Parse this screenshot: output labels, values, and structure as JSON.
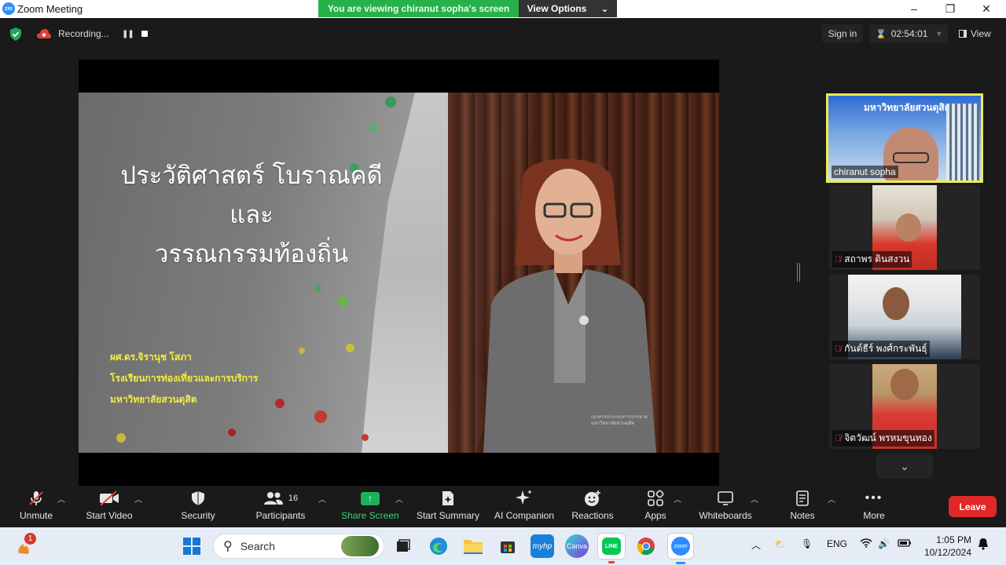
{
  "window": {
    "logo": "zm",
    "title": "Zoom Meeting",
    "controls": [
      "–",
      "❐",
      "✕"
    ]
  },
  "viewing_banner": {
    "message": "You are viewing chiranut sopha's screen",
    "options_label": "View Options"
  },
  "topbar": {
    "recording_label": "Recording...",
    "signin_label": "Sign in",
    "timer": "02:54:01",
    "view_label": "View"
  },
  "slide": {
    "title_lines": [
      "ประวัติศาสตร์ โบราณคดี",
      "และ",
      "วรรณกรรมท้องถิ่น"
    ],
    "author_lines": [
      "ผศ.ดร.จิรานุช  โสภา",
      "โรงเรียนการท่องเที่ยวและการบริการ",
      "มหาวิทยาลัยสวนดุสิต"
    ],
    "caption_lines": [
      "เอกสารประกอบการบรรยาย",
      "มหาวิทยาลัยสวนดุสิต"
    ]
  },
  "gallery": {
    "active_banner": "มหาวิทยาลัยสวนดุสิต",
    "participants": [
      {
        "name": "chiranut sopha",
        "muted": false
      },
      {
        "name": "สถาพร  ดินสงวน",
        "muted": true
      },
      {
        "name": "กันต์ธีร์ พงศ์กระพันธุ์",
        "muted": true
      },
      {
        "name": "จิตวัฒน์ พรหมขุนทอง",
        "muted": true
      }
    ]
  },
  "toolbar": {
    "unmute": "Unmute",
    "start_video": "Start Video",
    "security": "Security",
    "participants": "Participants",
    "participants_count": "16",
    "share_screen": "Share Screen",
    "start_summary": "Start Summary",
    "ai_companion": "AI Companion",
    "reactions": "Reactions",
    "apps": "Apps",
    "whiteboards": "Whiteboards",
    "notes": "Notes",
    "more": "More",
    "leave": "Leave"
  },
  "taskbar": {
    "notification_count": "1",
    "search_placeholder": "Search",
    "apps": [
      "Widgets",
      "Task View",
      "Edge",
      "File Explorer",
      "Microsoft Store",
      "myHP",
      "Canva",
      "LINE",
      "Chrome",
      "Zoom"
    ],
    "myhp_label": "myhp",
    "canva_label": "Canva",
    "line_label": "LINE",
    "zoom_label": "zoom",
    "language": "ENG",
    "time": "1:05 PM",
    "date": "10/12/2024"
  },
  "colors": {
    "share_green": "#1db25a",
    "leave_red": "#e02828",
    "active_border": "#f2ea52",
    "banner_green": "#27b14a"
  }
}
